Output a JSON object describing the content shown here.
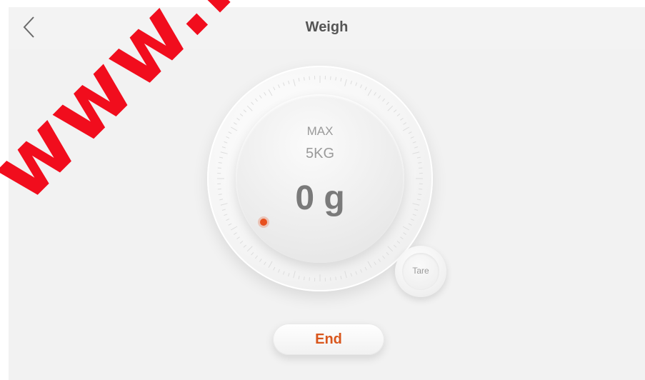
{
  "header": {
    "title": "Weigh",
    "back_icon": "chevron-left-icon"
  },
  "dial": {
    "max_label": "MAX",
    "max_value": "5KG",
    "reading": "0 g",
    "indicator_color": "#e8501e"
  },
  "tare": {
    "label": "Tare"
  },
  "end": {
    "label": "End",
    "color": "#d9561c"
  },
  "watermark": {
    "text": "www.k"
  }
}
